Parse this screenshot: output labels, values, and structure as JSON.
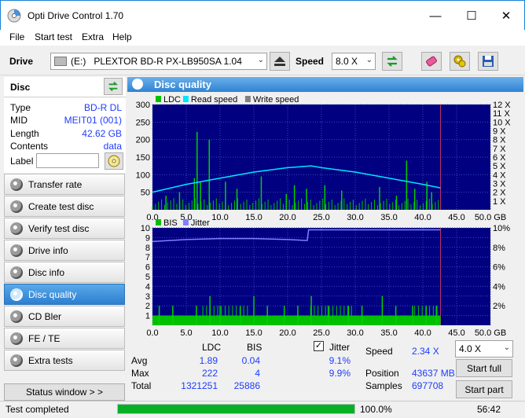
{
  "window": {
    "title": "Opti Drive Control 1.70"
  },
  "menu": [
    "File",
    "Start test",
    "Extra",
    "Help"
  ],
  "toolbar": {
    "drive_label": "Drive",
    "drive_letter": "(E:)",
    "drive_value": "PLEXTOR BD-R  PX-LB950SA 1.04",
    "speed_label": "Speed",
    "speed_value": "8.0 X"
  },
  "disc": {
    "header": "Disc",
    "rows": [
      {
        "label": "Type",
        "value": "BD-R DL"
      },
      {
        "label": "MID",
        "value": "MEIT01 (001)"
      },
      {
        "label": "Length",
        "value": "42.62 GB"
      },
      {
        "label": "Contents",
        "value": "data"
      }
    ],
    "label_label": "Label",
    "label_value": ""
  },
  "nav": [
    {
      "label": "Transfer rate",
      "active": false
    },
    {
      "label": "Create test disc",
      "active": false
    },
    {
      "label": "Verify test disc",
      "active": false
    },
    {
      "label": "Drive info",
      "active": false
    },
    {
      "label": "Disc info",
      "active": false
    },
    {
      "label": "Disc quality",
      "active": true
    },
    {
      "label": "CD Bler",
      "active": false
    },
    {
      "label": "FE / TE",
      "active": false
    },
    {
      "label": "Extra tests",
      "active": false
    }
  ],
  "status_window_label": "Status window > >",
  "panel_title": "Disc quality",
  "chart_data": [
    {
      "type": "bar",
      "legend": [
        "LDC",
        "Read speed",
        "Write speed"
      ],
      "colors": {
        "LDC": "#00c000",
        "Read speed": "#00e5ff",
        "Write speed": "#808080"
      },
      "x_ticks": [
        "0.0",
        "5.0",
        "10.0",
        "15.0",
        "20.0",
        "25.0",
        "30.0",
        "35.0",
        "40.0",
        "45.0",
        "50.0 GB"
      ],
      "y_ticks_left": [
        "300",
        "250",
        "200",
        "150",
        "100",
        "50"
      ],
      "y_ticks_right": [
        "12 X",
        "11 X",
        "10 X",
        "9 X",
        "8 X",
        "7 X",
        "6 X",
        "5 X",
        "4 X",
        "3 X",
        "2 X",
        "1 X"
      ],
      "xlim": [
        0,
        50
      ],
      "ylim": [
        0,
        300
      ],
      "y2lim": [
        0,
        12
      ],
      "read_speed": {
        "x": [
          0,
          5,
          10,
          15,
          20,
          23.5,
          25,
          30,
          35,
          40,
          42.6
        ],
        "y": [
          2.0,
          2.9,
          3.6,
          4.3,
          4.8,
          5.0,
          4.8,
          4.3,
          3.6,
          2.9,
          2.5
        ]
      },
      "ldc_spikes": {
        "x": [
          2,
          4,
          6.2,
          6.6,
          7.1,
          8.4,
          10.8,
          12.5,
          16.1,
          19.8,
          21,
          22.8,
          25.5,
          28,
          33.6,
          36.1,
          37.6,
          38.8,
          40.6,
          41.3
        ],
        "y": [
          40,
          50,
          90,
          222,
          80,
          200,
          80,
          60,
          95,
          45,
          70,
          60,
          70,
          55,
          65,
          40,
          140,
          60,
          80,
          50
        ]
      },
      "ldc_base": 22,
      "disc_end_gb": 42.62
    },
    {
      "type": "bar",
      "legend": [
        "BIS",
        "Jitter"
      ],
      "colors": {
        "BIS": "#00c000",
        "Jitter": "#8080ff"
      },
      "x_ticks": [
        "0.0",
        "5.0",
        "10.0",
        "15.0",
        "20.0",
        "25.0",
        "30.0",
        "35.0",
        "40.0",
        "45.0",
        "50.0 GB"
      ],
      "y_ticks_left": [
        "10",
        "9",
        "8",
        "7",
        "6",
        "5",
        "4",
        "3",
        "2",
        "1"
      ],
      "y_ticks_right": [
        "10%",
        "8%",
        "6%",
        "4%",
        "2%"
      ],
      "xlim": [
        0,
        50
      ],
      "ylim": [
        0,
        10
      ],
      "y2lim": [
        0,
        10
      ],
      "jitter": {
        "x": [
          0,
          5,
          10,
          15,
          20,
          22.9,
          23.1,
          30,
          35,
          40,
          42.6
        ],
        "y": [
          8.6,
          8.8,
          8.9,
          8.9,
          8.8,
          8.7,
          9.8,
          9.8,
          9.8,
          9.8,
          9.8
        ]
      },
      "bis_base": 1,
      "bis_spikes": {
        "x": [
          1,
          3,
          6.5,
          8.5,
          10,
          13,
          15,
          17,
          19.5,
          21.5,
          23.5,
          26,
          29,
          31,
          34,
          36,
          38.5,
          40.5,
          42
        ],
        "y": [
          2,
          2,
          2,
          3,
          2,
          2,
          3,
          2,
          2,
          2,
          3,
          2,
          2,
          2,
          3,
          2,
          2,
          2,
          2
        ]
      },
      "disc_end_gb": 42.62
    }
  ],
  "stats": {
    "col_ldc": "LDC",
    "col_bis": "BIS",
    "avg_label": "Avg",
    "max_label": "Max",
    "total_label": "Total",
    "avg_ldc": "1.89",
    "avg_bis": "0.04",
    "max_ldc": "222",
    "max_bis": "4",
    "total_ldc": "1321251",
    "total_bis": "25886",
    "jitter_label": "Jitter",
    "jitter_avg": "9.1%",
    "jitter_max": "9.9%",
    "speed_label": "Speed",
    "speed_value": "2.34 X",
    "position_label": "Position",
    "position_value": "43637 MB",
    "samples_label": "Samples",
    "samples_value": "697708",
    "speed_select": "4.0 X",
    "start_full": "Start full",
    "start_part": "Start part"
  },
  "status": {
    "text": "Test completed",
    "progress_fraction": 1.0,
    "progress_text": "100.0%",
    "time": "56:42"
  }
}
